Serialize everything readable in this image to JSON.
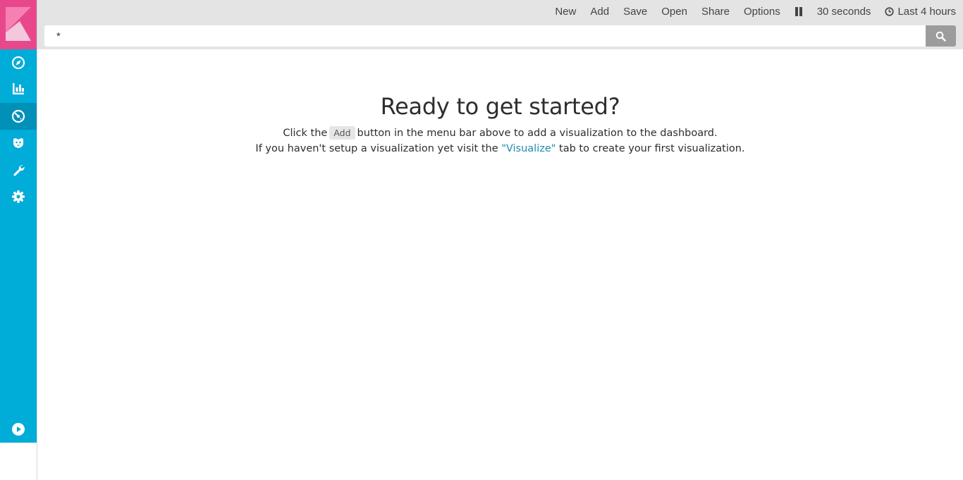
{
  "menu": {
    "new": "New",
    "add": "Add",
    "save": "Save",
    "open": "Open",
    "share": "Share",
    "options": "Options",
    "refresh_interval": "30 seconds",
    "time_range": "Last 4 hours"
  },
  "search": {
    "value": "*"
  },
  "sidebar": {
    "items": [
      {
        "icon": "compass-icon",
        "label": "Discover"
      },
      {
        "icon": "bar-chart-icon",
        "label": "Visualize"
      },
      {
        "icon": "dashboard-icon",
        "label": "Dashboard"
      },
      {
        "icon": "timelion-icon",
        "label": "Timelion"
      },
      {
        "icon": "wrench-icon",
        "label": "Dev Tools"
      },
      {
        "icon": "gear-icon",
        "label": "Management"
      }
    ],
    "active_index": 2
  },
  "empty_state": {
    "title": "Ready to get started?",
    "line1_before": "Click the",
    "add_label": "Add",
    "line1_after": "button in the menu bar above to add a visualization to the dashboard.",
    "line2_before": "If you haven't setup a visualization yet visit the",
    "link_text": "\"Visualize\"",
    "line2_after": "tab to create your first visualization."
  },
  "colors": {
    "sidebar": "#00acd8",
    "sidebar_active": "#0090b8",
    "logo": "#e8488b",
    "topbar": "#e4e4e4",
    "link": "#1f8bb3"
  }
}
